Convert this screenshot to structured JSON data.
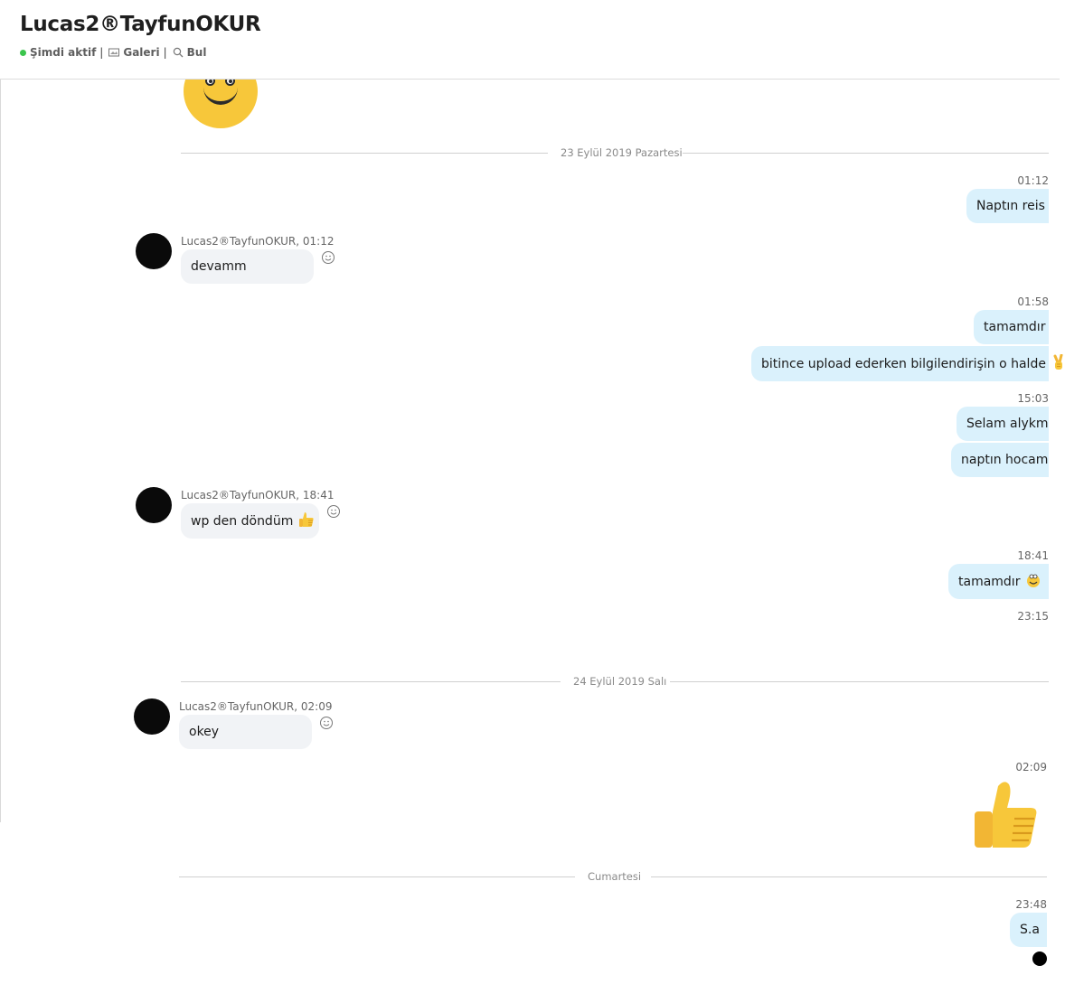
{
  "header": {
    "title": "Lucas2®TayfunOKUR",
    "status": "Şimdi aktif",
    "gallery_label": "Galeri",
    "find_label": "Bul",
    "separator": "|"
  },
  "date_separators": [
    "23 Eylül 2019 Pazartesi",
    "24 Eylül 2019 Salı",
    "Cumartesi"
  ],
  "messages": [
    {
      "direction": "out",
      "time": "01:12",
      "texts": [
        "Naptın reis"
      ]
    },
    {
      "direction": "in",
      "sender": "Lucas2®TayfunOKUR, 01:12",
      "texts": [
        "devamm"
      ]
    },
    {
      "direction": "out",
      "time": "01:58",
      "texts": [
        "tamamdır",
        "bitince upload ederken bilgilendirişin o halde"
      ],
      "emoji": "victory-hand"
    },
    {
      "direction": "out",
      "time": "15:03",
      "texts": [
        "Selam alykm",
        "naptın hocam"
      ]
    },
    {
      "direction": "in",
      "sender": "Lucas2®TayfunOKUR, 18:41",
      "texts": [
        "wp den döndüm"
      ],
      "emoji": "thumbs-up"
    },
    {
      "direction": "out",
      "time": "18:41",
      "texts": [
        "tamamdır"
      ],
      "emoji": "smile"
    },
    {
      "direction": "out",
      "time": "23:15",
      "texts": []
    },
    {
      "direction": "in",
      "sender": "Lucas2®TayfunOKUR, 02:09",
      "texts": [
        "okey"
      ]
    },
    {
      "direction": "out",
      "time": "02:09",
      "texts": [],
      "emoji": "thumbs-up-large"
    },
    {
      "direction": "out",
      "time": "23:48",
      "texts": [
        "S.a"
      ]
    }
  ],
  "colors": {
    "outgoing_bubble": "#daf1fc",
    "incoming_bubble": "#f1f3f6",
    "online": "#3bc54d",
    "emoji_yellow": "#f7c73a"
  }
}
